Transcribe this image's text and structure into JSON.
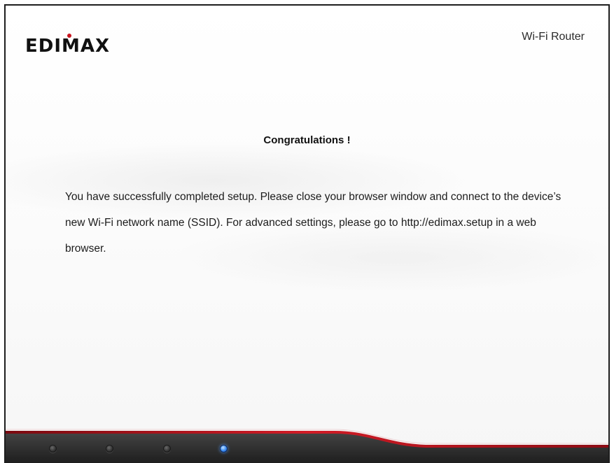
{
  "header": {
    "brand": "EDIMAX",
    "product_name": "Wi-Fi Router"
  },
  "main": {
    "heading": "Congratulations !",
    "message": "You have successfully completed setup. Please close your browser window and connect to the device’s new Wi-Fi network name (SSID). For advanced settings, please go to http://edimax.setup in a web browser."
  },
  "footer": {
    "steps": [
      {
        "state": "inactive"
      },
      {
        "state": "inactive"
      },
      {
        "state": "inactive"
      },
      {
        "state": "active"
      }
    ]
  },
  "colors": {
    "accent_red": "#b3101a",
    "footer_dark": "#2a2a2a",
    "active_step": "#3c8cf0"
  }
}
